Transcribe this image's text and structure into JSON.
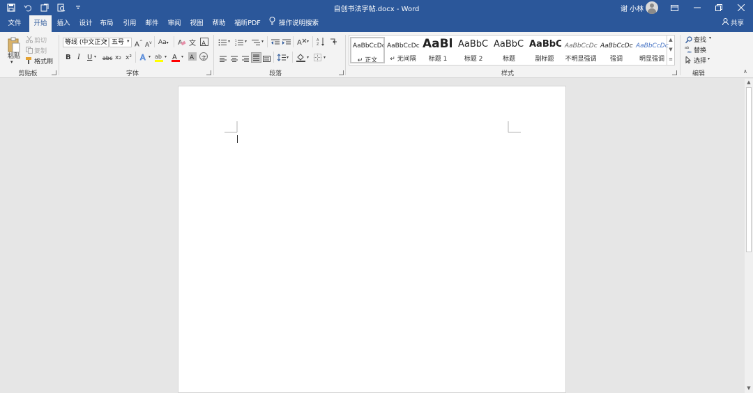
{
  "window": {
    "title": "自创书法字帖.docx  -  Word",
    "user_name": "谢 小林",
    "min_icon": "minimize-icon",
    "max_icon": "restore-icon",
    "close_icon": "close-icon"
  },
  "qat": [
    "save-icon",
    "undo-icon",
    "redo-icon",
    "print-preview-icon",
    "customize-qat-icon"
  ],
  "tabs": [
    "文件",
    "开始",
    "插入",
    "设计",
    "布局",
    "引用",
    "邮件",
    "审阅",
    "视图",
    "帮助",
    "福昕PDF"
  ],
  "active_tab": "开始",
  "tell_me": "操作说明搜索",
  "share": "共享",
  "clipboard": {
    "paste": "粘贴",
    "cut": "剪切",
    "copy": "复制",
    "format_painter": "格式刷",
    "label": "剪贴板"
  },
  "font": {
    "font_name": "等线 (中文正文",
    "font_size": "五号",
    "label": "字体",
    "change_case": "Aa",
    "bold": "B",
    "italic": "I",
    "underline": "U",
    "strikethrough": "abc",
    "subscript": "x₂",
    "superscript": "x²"
  },
  "paragraph": {
    "label": "段落"
  },
  "styles": {
    "label": "样式",
    "items": [
      {
        "sample": "AaBbCcDc",
        "name": "↵ 正文"
      },
      {
        "sample": "AaBbCcDc",
        "name": "↵ 无间隔"
      },
      {
        "sample": "AaBl",
        "name": "标题 1"
      },
      {
        "sample": "AaBbC",
        "name": "标题 2"
      },
      {
        "sample": "AaBbC",
        "name": "标题"
      },
      {
        "sample": "AaBbC",
        "name": "副标题"
      },
      {
        "sample": "AaBbCcDc",
        "name": "不明显强调"
      },
      {
        "sample": "AaBbCcDc",
        "name": "强调"
      },
      {
        "sample": "AaBbCcDc",
        "name": "明显强调"
      }
    ]
  },
  "editing": {
    "find": "查找",
    "replace": "替换",
    "select": "选择",
    "label": "编辑"
  },
  "colors": {
    "accent": "#2b579a",
    "ribbon": "#f3f3f3",
    "canvas": "#e6e6e6",
    "highlight": "#ffff00",
    "font_color": "#ff0000"
  }
}
